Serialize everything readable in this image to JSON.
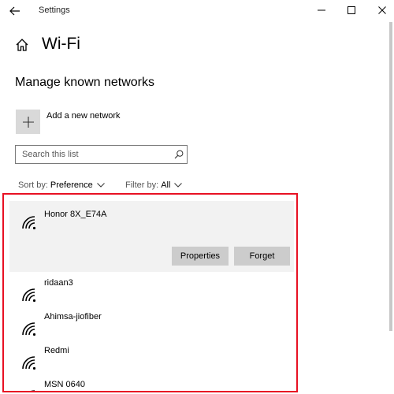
{
  "window": {
    "title": "Settings"
  },
  "header": {
    "page_title": "Wi-Fi",
    "section_title": "Manage known networks"
  },
  "add_network": {
    "label": "Add a new network",
    "icon": "plus-icon"
  },
  "search": {
    "placeholder": "Search this list",
    "value": ""
  },
  "sort": {
    "label": "Sort by:",
    "value": "Preference"
  },
  "filter": {
    "label": "Filter by:",
    "value": "All"
  },
  "networks": [
    {
      "name": "Honor 8X_E74A",
      "selected": true
    },
    {
      "name": "ridaan3",
      "selected": false
    },
    {
      "name": "Ahimsa-jiofiber",
      "selected": false
    },
    {
      "name": "Redmi",
      "selected": false
    },
    {
      "name": "MSN 0640",
      "selected": false
    }
  ],
  "actions": {
    "properties_label": "Properties",
    "forget_label": "Forget"
  },
  "colors": {
    "highlight_border": "#e81123",
    "selected_background": "#f2f2f2",
    "button_background": "#cccccc"
  }
}
